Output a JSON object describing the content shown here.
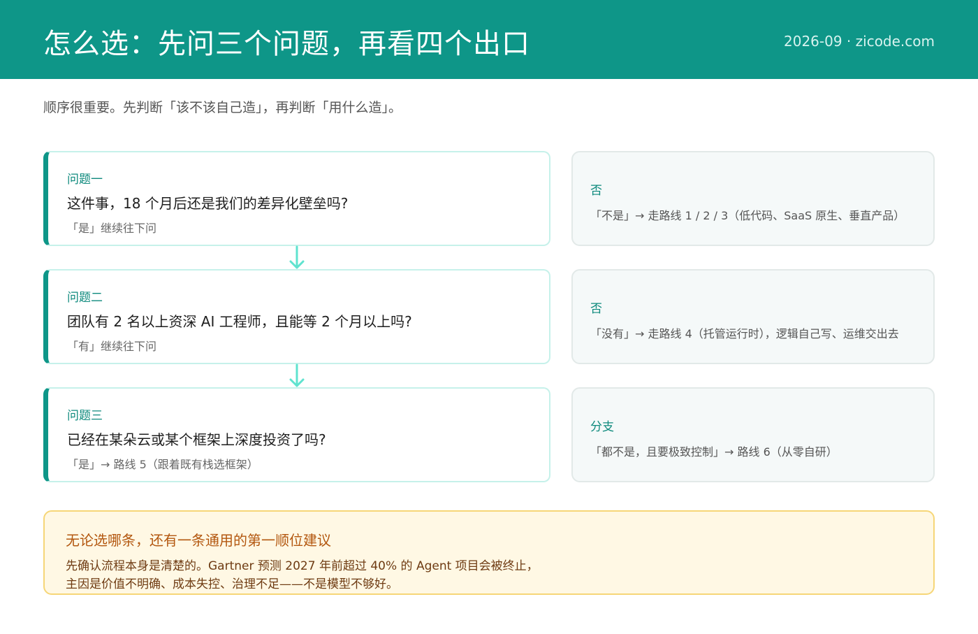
{
  "header": {
    "title": "怎么选：先问三个问题，再看四个出口",
    "meta": "2026-09 · zicode.com"
  },
  "subtitle": "顺序很重要。先判断「该不该自己造」，再判断「用什么造」。",
  "questions": [
    {
      "label": "问题一",
      "text": "这件事，18 个月后还是我们的差异化壁垒吗?",
      "note": "「是」继续往下问"
    },
    {
      "label": "问题二",
      "text": "团队有 2 名以上资深 AI 工程师，且能等 2 个月以上吗?",
      "note": "「有」继续往下问"
    },
    {
      "label": "问题三",
      "text": "已经在某朵云或某个框架上深度投资了吗?",
      "note": "「是」→ 路线 5（跟着既有栈选框架）"
    }
  ],
  "answers": [
    {
      "label": "否",
      "text": "「不是」→ 走路线 1 / 2 / 3（低代码、SaaS 原生、垂直产品）"
    },
    {
      "label": "否",
      "text": "「没有」→ 走路线 4（托管运行时），逻辑自己写、运维交出去"
    },
    {
      "label": "分支",
      "text": "「都不是，且要极致控制」→ 路线 6（从零自研）"
    }
  ],
  "note": {
    "title": "无论选哪条，还有一条通用的第一顺位建议",
    "line1": "先确认流程本身是清楚的。Gartner 预测 2027 年前超过 40% 的 Agent 项目会被终止，",
    "line2": "主因是价值不明确、成本失控、治理不足——不是模型不够好。"
  },
  "colors": {
    "brand": "#0e9688",
    "arrow": "#5fe3cf",
    "note_border": "#f6d677",
    "note_title": "#b3570f"
  },
  "icons": {
    "connector": "arrow-down-icon"
  }
}
